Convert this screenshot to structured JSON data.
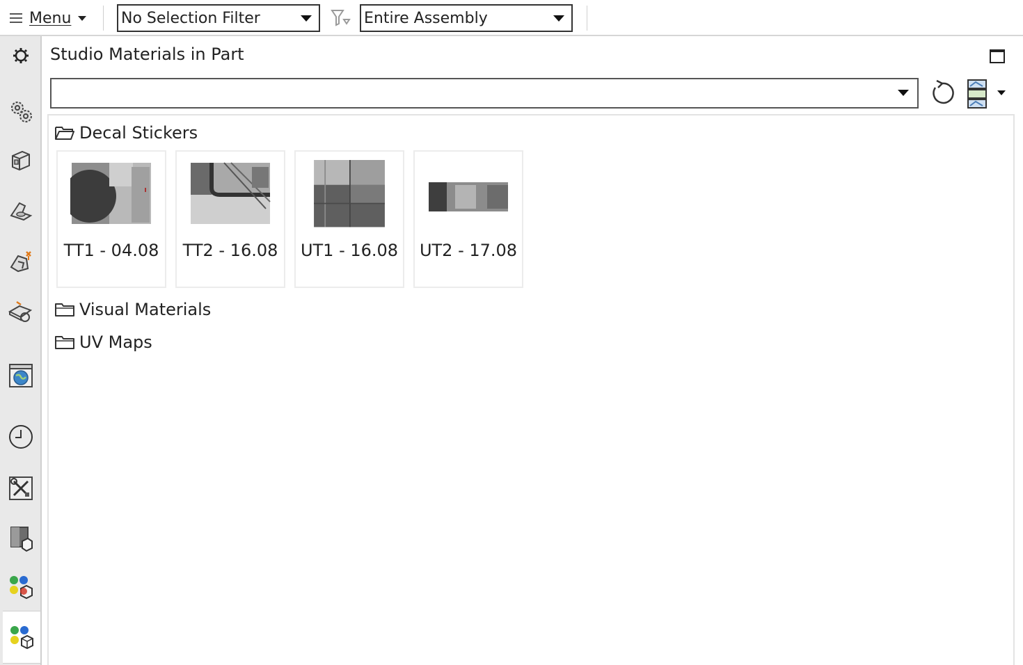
{
  "toolbar": {
    "menu_label": "Menu",
    "selection_filter": "No Selection Filter",
    "scope": "Entire Assembly"
  },
  "panel": {
    "title": "Studio Materials in Part",
    "library_value": ""
  },
  "tree": {
    "folders": [
      {
        "label": "Decal Stickers",
        "expanded": true
      },
      {
        "label": "Visual Materials",
        "expanded": false
      },
      {
        "label": "UV Maps",
        "expanded": false
      }
    ],
    "decals": [
      {
        "label": "TT1 - 04.08"
      },
      {
        "label": "TT2 - 16.08"
      },
      {
        "label": "UT1 - 16.08"
      },
      {
        "label": "UT2 - 17.08"
      }
    ]
  },
  "rail": {
    "icons": [
      "settings-icon",
      "gears-icon",
      "part-icon",
      "feature-icon",
      "constraint-icon",
      "motion-icon",
      "browser-icon",
      "history-icon",
      "tools-icon",
      "texture-icon",
      "system-materials-icon",
      "studio-materials-icon"
    ],
    "active": "studio-materials-icon"
  },
  "colors": {
    "rail_bg": "#e9e9e9",
    "accent_blue": "#2a6bd1",
    "accent_green": "#3aa64b",
    "accent_yellow": "#e6d21e",
    "accent_red": "#d23a2a"
  }
}
